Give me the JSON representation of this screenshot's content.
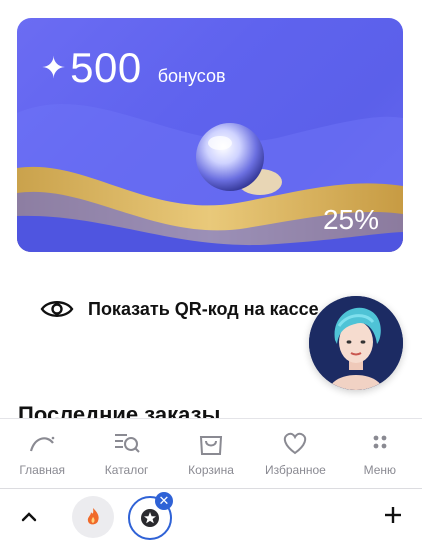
{
  "bonus_card": {
    "star": "✦",
    "amount": "500",
    "unit": "бонусов",
    "percent": "25%"
  },
  "qr": {
    "label": "Показать QR-код на кассе"
  },
  "section": {
    "title": "Последние заказы"
  },
  "tabbar": {
    "items": [
      {
        "label": "Главная",
        "icon": "home-arc-icon"
      },
      {
        "label": "Каталог",
        "icon": "catalog-search-icon"
      },
      {
        "label": "Корзина",
        "icon": "cart-bag-icon"
      },
      {
        "label": "Избранное",
        "icon": "heart-icon"
      },
      {
        "label": "Меню",
        "icon": "menu-dots-icon"
      }
    ]
  },
  "browser": {
    "close_glyph": "✕"
  },
  "colors": {
    "card_blue": "#5f63ee",
    "gold": "#d8b25a",
    "active_ring": "#2f62d6",
    "tab_label": "#8a8a92"
  }
}
